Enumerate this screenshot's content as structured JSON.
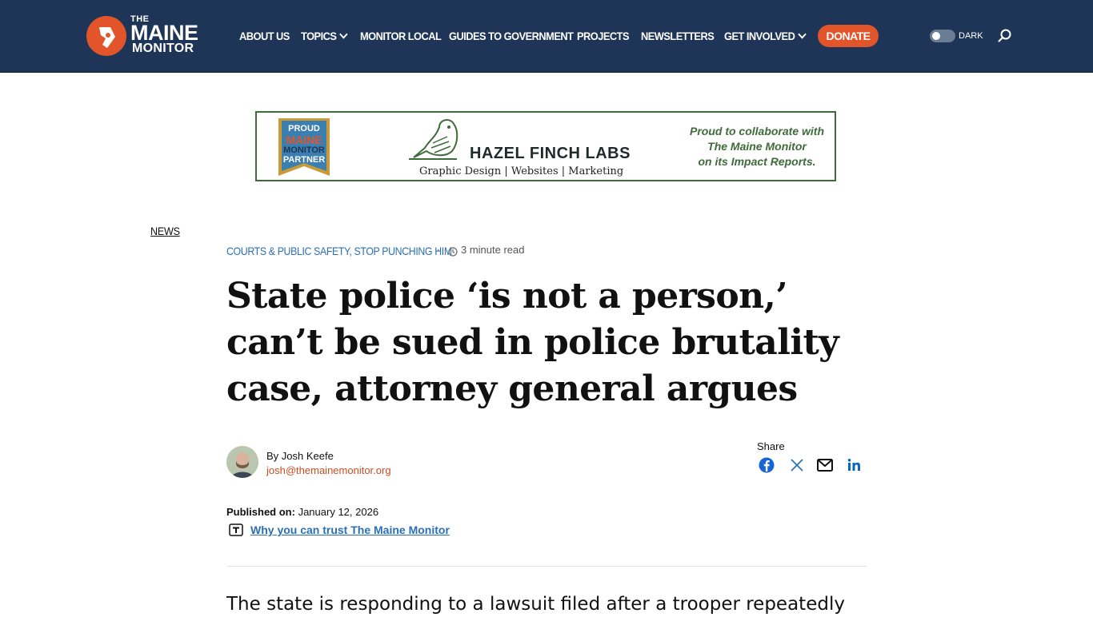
{
  "site": {
    "logo_the": "THE",
    "logo_maine": "MAINE",
    "logo_monitor": "MONITOR"
  },
  "nav": {
    "items": [
      {
        "label": "ABOUT US",
        "has_dropdown": false
      },
      {
        "label": "TOPICS",
        "has_dropdown": true
      },
      {
        "label": "MONITOR LOCAL",
        "has_dropdown": false
      },
      {
        "label": "GUIDES TO GOVERNMENT",
        "has_dropdown": false
      },
      {
        "label": "PROJECTS",
        "has_dropdown": false
      },
      {
        "label": "NEWSLETTERS",
        "has_dropdown": false
      },
      {
        "label": "GET INVOLVED",
        "has_dropdown": true
      }
    ],
    "donate_label": "DONATE",
    "dark_label": "DARK"
  },
  "ad": {
    "badge_line1": "PROUD",
    "badge_line2": "MAINE",
    "badge_line3": "MONITOR",
    "badge_line4": "PARTNER",
    "brand": "HAZEL FINCH LABS",
    "services": "Graphic Design | Websites | Marketing",
    "tagline_line1": "Proud to collaborate with",
    "tagline_line2": "The Maine Monitor",
    "tagline_line3": "on its Impact Reports."
  },
  "article": {
    "section": "NEWS",
    "categories": "COURTS & PUBLIC SAFETY, STOP PUNCHING HIM",
    "read_time": "3 minute read",
    "headline": "State police ‘is not a person,’ can’t be sued in police brutality case, attorney general argues",
    "byline": "By Josh Keefe",
    "author_email": "josh@themainemonitor.org",
    "share_label": "Share",
    "published_label": "Published on:",
    "published_date": "January 12, 2026",
    "trust_link": "Why you can trust The Maine Monitor",
    "lede": "The state is responding to a lawsuit filed after a trooper repeatedly"
  },
  "colors": {
    "header_bg": "#1f3557",
    "accent_orange": "#e2542a",
    "link_blue": "#2a6fb5",
    "ad_green": "#3f6b3a"
  },
  "icons": {
    "share": [
      "facebook-icon",
      "x-icon",
      "email-icon",
      "linkedin-icon"
    ],
    "search": "search-icon",
    "clock": "clock-icon",
    "trust": "trust-icon"
  }
}
